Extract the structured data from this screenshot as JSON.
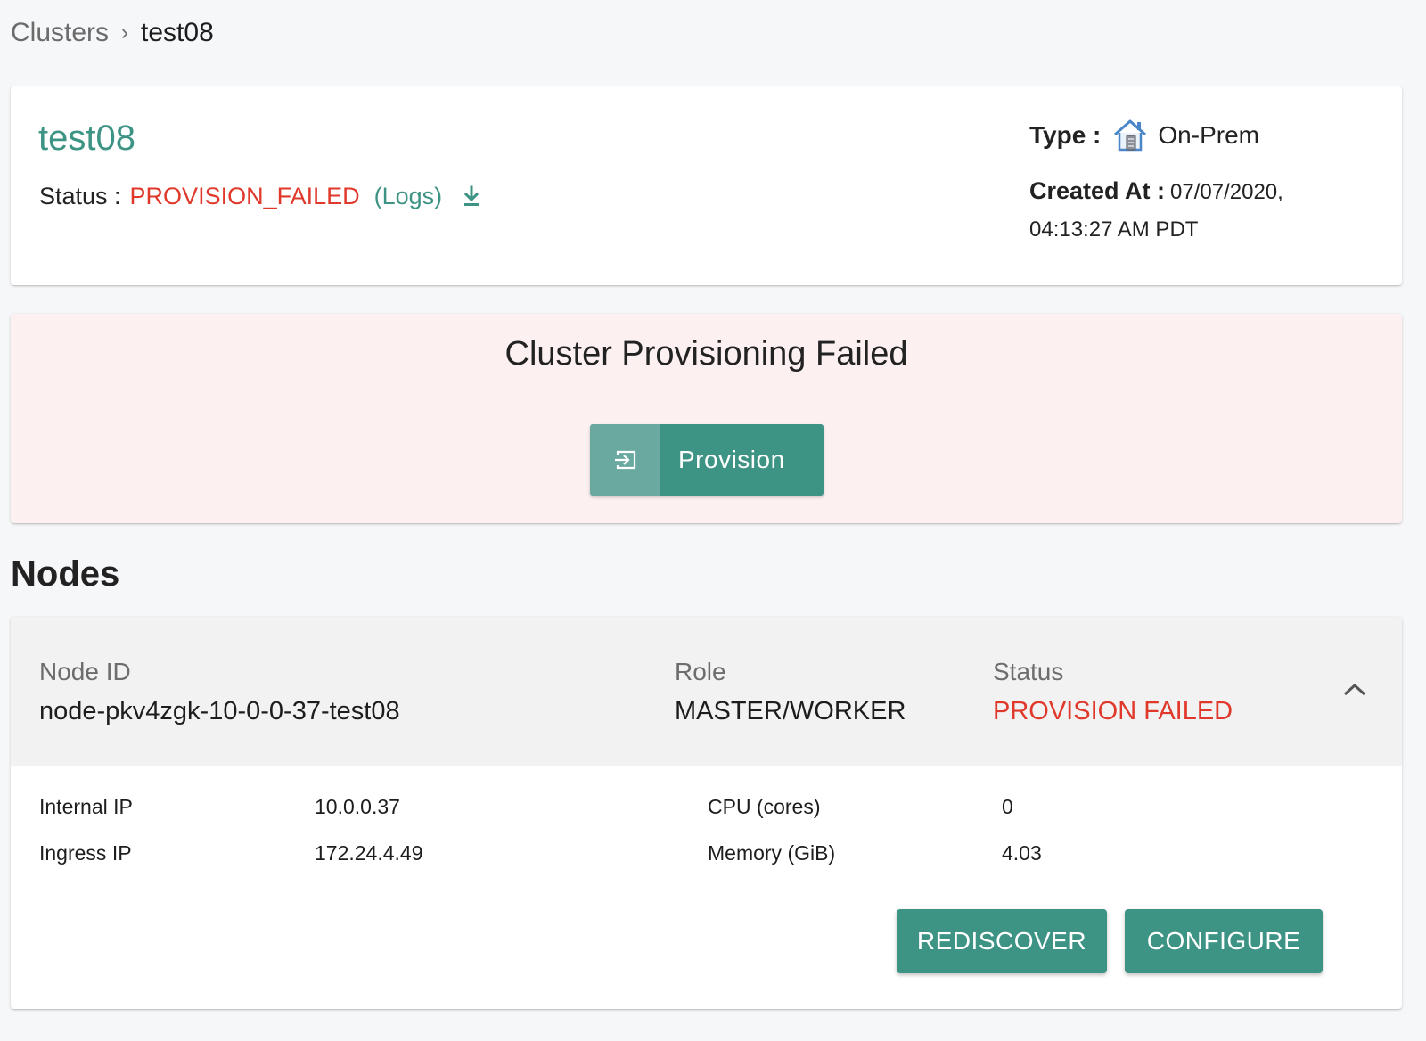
{
  "breadcrumb": {
    "parent": "Clusters",
    "separator": "›",
    "current": "test08"
  },
  "cluster": {
    "name": "test08",
    "status_label": "Status :",
    "status_value": "PROVISION_FAILED",
    "logs_label": "(Logs)",
    "type_label": "Type :",
    "type_value": "On-Prem",
    "created_label": "Created At :",
    "created_value": "07/07/2020, 04:13:27 AM PDT"
  },
  "banner": {
    "title": "Cluster Provisioning Failed",
    "provision_label": "Provision"
  },
  "nodes": {
    "heading": "Nodes",
    "columns": {
      "node_id": "Node ID",
      "role": "Role",
      "status": "Status"
    },
    "items": [
      {
        "node_id": "node-pkv4zgk-10-0-0-37-test08",
        "role": "MASTER/WORKER",
        "status": "PROVISION FAILED",
        "details": {
          "internal_ip_label": "Internal IP",
          "internal_ip": "10.0.0.37",
          "ingress_ip_label": "Ingress IP",
          "ingress_ip": "172.24.4.49",
          "cpu_label": "CPU (cores)",
          "cpu": "0",
          "memory_label": "Memory (GiB)",
          "memory": "4.03"
        },
        "actions": {
          "rediscover": "REDISCOVER",
          "configure": "CONFIGURE"
        }
      }
    ]
  },
  "colors": {
    "accent": "#3d9485",
    "error": "#e0392b",
    "banner_bg": "#fdf0f0"
  },
  "icons": {
    "download": "download-icon",
    "house": "on-prem-house-icon",
    "provision": "login-arrow-icon",
    "collapse": "chevron-up-icon"
  }
}
